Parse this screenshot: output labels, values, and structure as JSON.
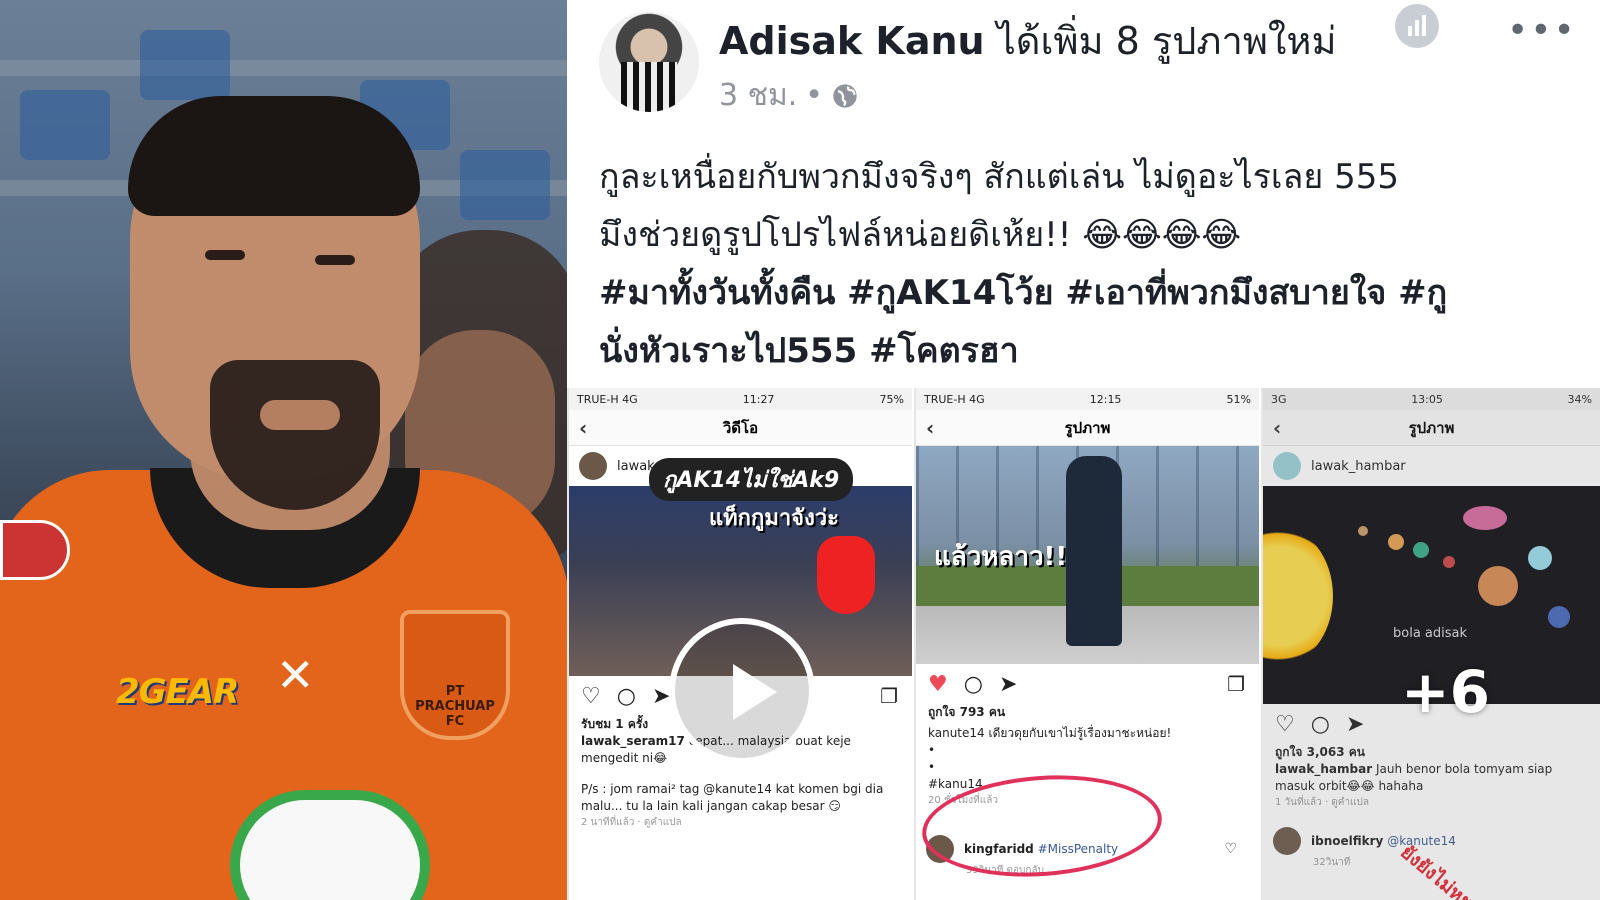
{
  "post": {
    "author": "Adisak Kanu",
    "action": "ได้เพิ่ม 8 รูปภาพใหม่",
    "time": "3 ชม.",
    "separator": "•",
    "privacy_icon": "globe-icon",
    "caption_lines": [
      "กูละเหนื่อยกับพวกมึงจริงๆ สักแต่เล่น ไม่ดูอะไรเลย 555",
      "มึงช่วยดูรูปโปรไฟล์หน่อยดิเห้ย!! 😂😂😂😂"
    ],
    "hashtag_lines": [
      "#มาทั้งวันทั้งคืน  #กูAK14โว้ย  #เอาที่พวกมึงสบายใจ #กู",
      "นั่งหัวเราะไป555 #โคตรฮา"
    ],
    "more_photos": "+6"
  },
  "photo": {
    "sponsor": "2GEAR",
    "crest_text": "PT PRACHUAP FC"
  },
  "shots": [
    {
      "status_left": "TRUE-H  4G",
      "status_time": "11:27",
      "status_right": "75%",
      "nav_title": "วิดีโอ",
      "username": "lawak_seram17",
      "overlay_title": "กูAK14ไม่ใช่Ak9",
      "overlay_sub": "แท็กกูมาจังว่ะ",
      "views": "รับชม 1 ครั้ง",
      "caption_user": "lawak_seram17",
      "caption_text": "cepat... malaysia buat keje mengedit ni😂",
      "comment": "P/s : jom ramai² tag @kanute14 kat komen bgi dia malu... tu la lain kali jangan cakap besar 😏",
      "time": "2 นาทีที่แล้ว · ดูคำแปล"
    },
    {
      "status_left": "TRUE-H  4G",
      "status_time": "12:15",
      "status_right": "51%",
      "nav_title": "รูปภาพ",
      "overlay_sub": "แล้วหลาว!!",
      "likes": "ถูกใจ 793 คน",
      "caption": "kanute14 เดียวดุยกับเขาไม่รู้เรื่องมาชะหน่อย!",
      "tag": "#kanu14",
      "time": "20 ชั่วโมงที่แล้ว",
      "comment_user": "kingfaridd",
      "comment_text": "#MissPenalty",
      "comment_time": "59วินาที  ตอบกลับ"
    },
    {
      "status_left": "3G",
      "status_time": "13:05",
      "status_right": "34%",
      "nav_title": "รูปภาพ",
      "username": "lawak_hambar",
      "overlay_sub": "bola adisak",
      "likes": "ถูกใจ 3,063 คน",
      "caption_user": "lawak_hambar",
      "caption_text": "Jauh benor bola tomyam siap masuk orbit😂😂 hahaha",
      "time": "1 วันที่แล้ว · ดูคำแปล",
      "comment_user": "ibnoelfikry",
      "comment_text": "@kanute14",
      "comment_time": "32วินาที",
      "stamp": "ยังยังไม่หยุดอีก"
    }
  ],
  "colors": {
    "text": "#1d2129",
    "meta": "#90949c",
    "jersey": "#e2651b",
    "heart": "#ed4956",
    "circle_mark": "#e0315b"
  }
}
